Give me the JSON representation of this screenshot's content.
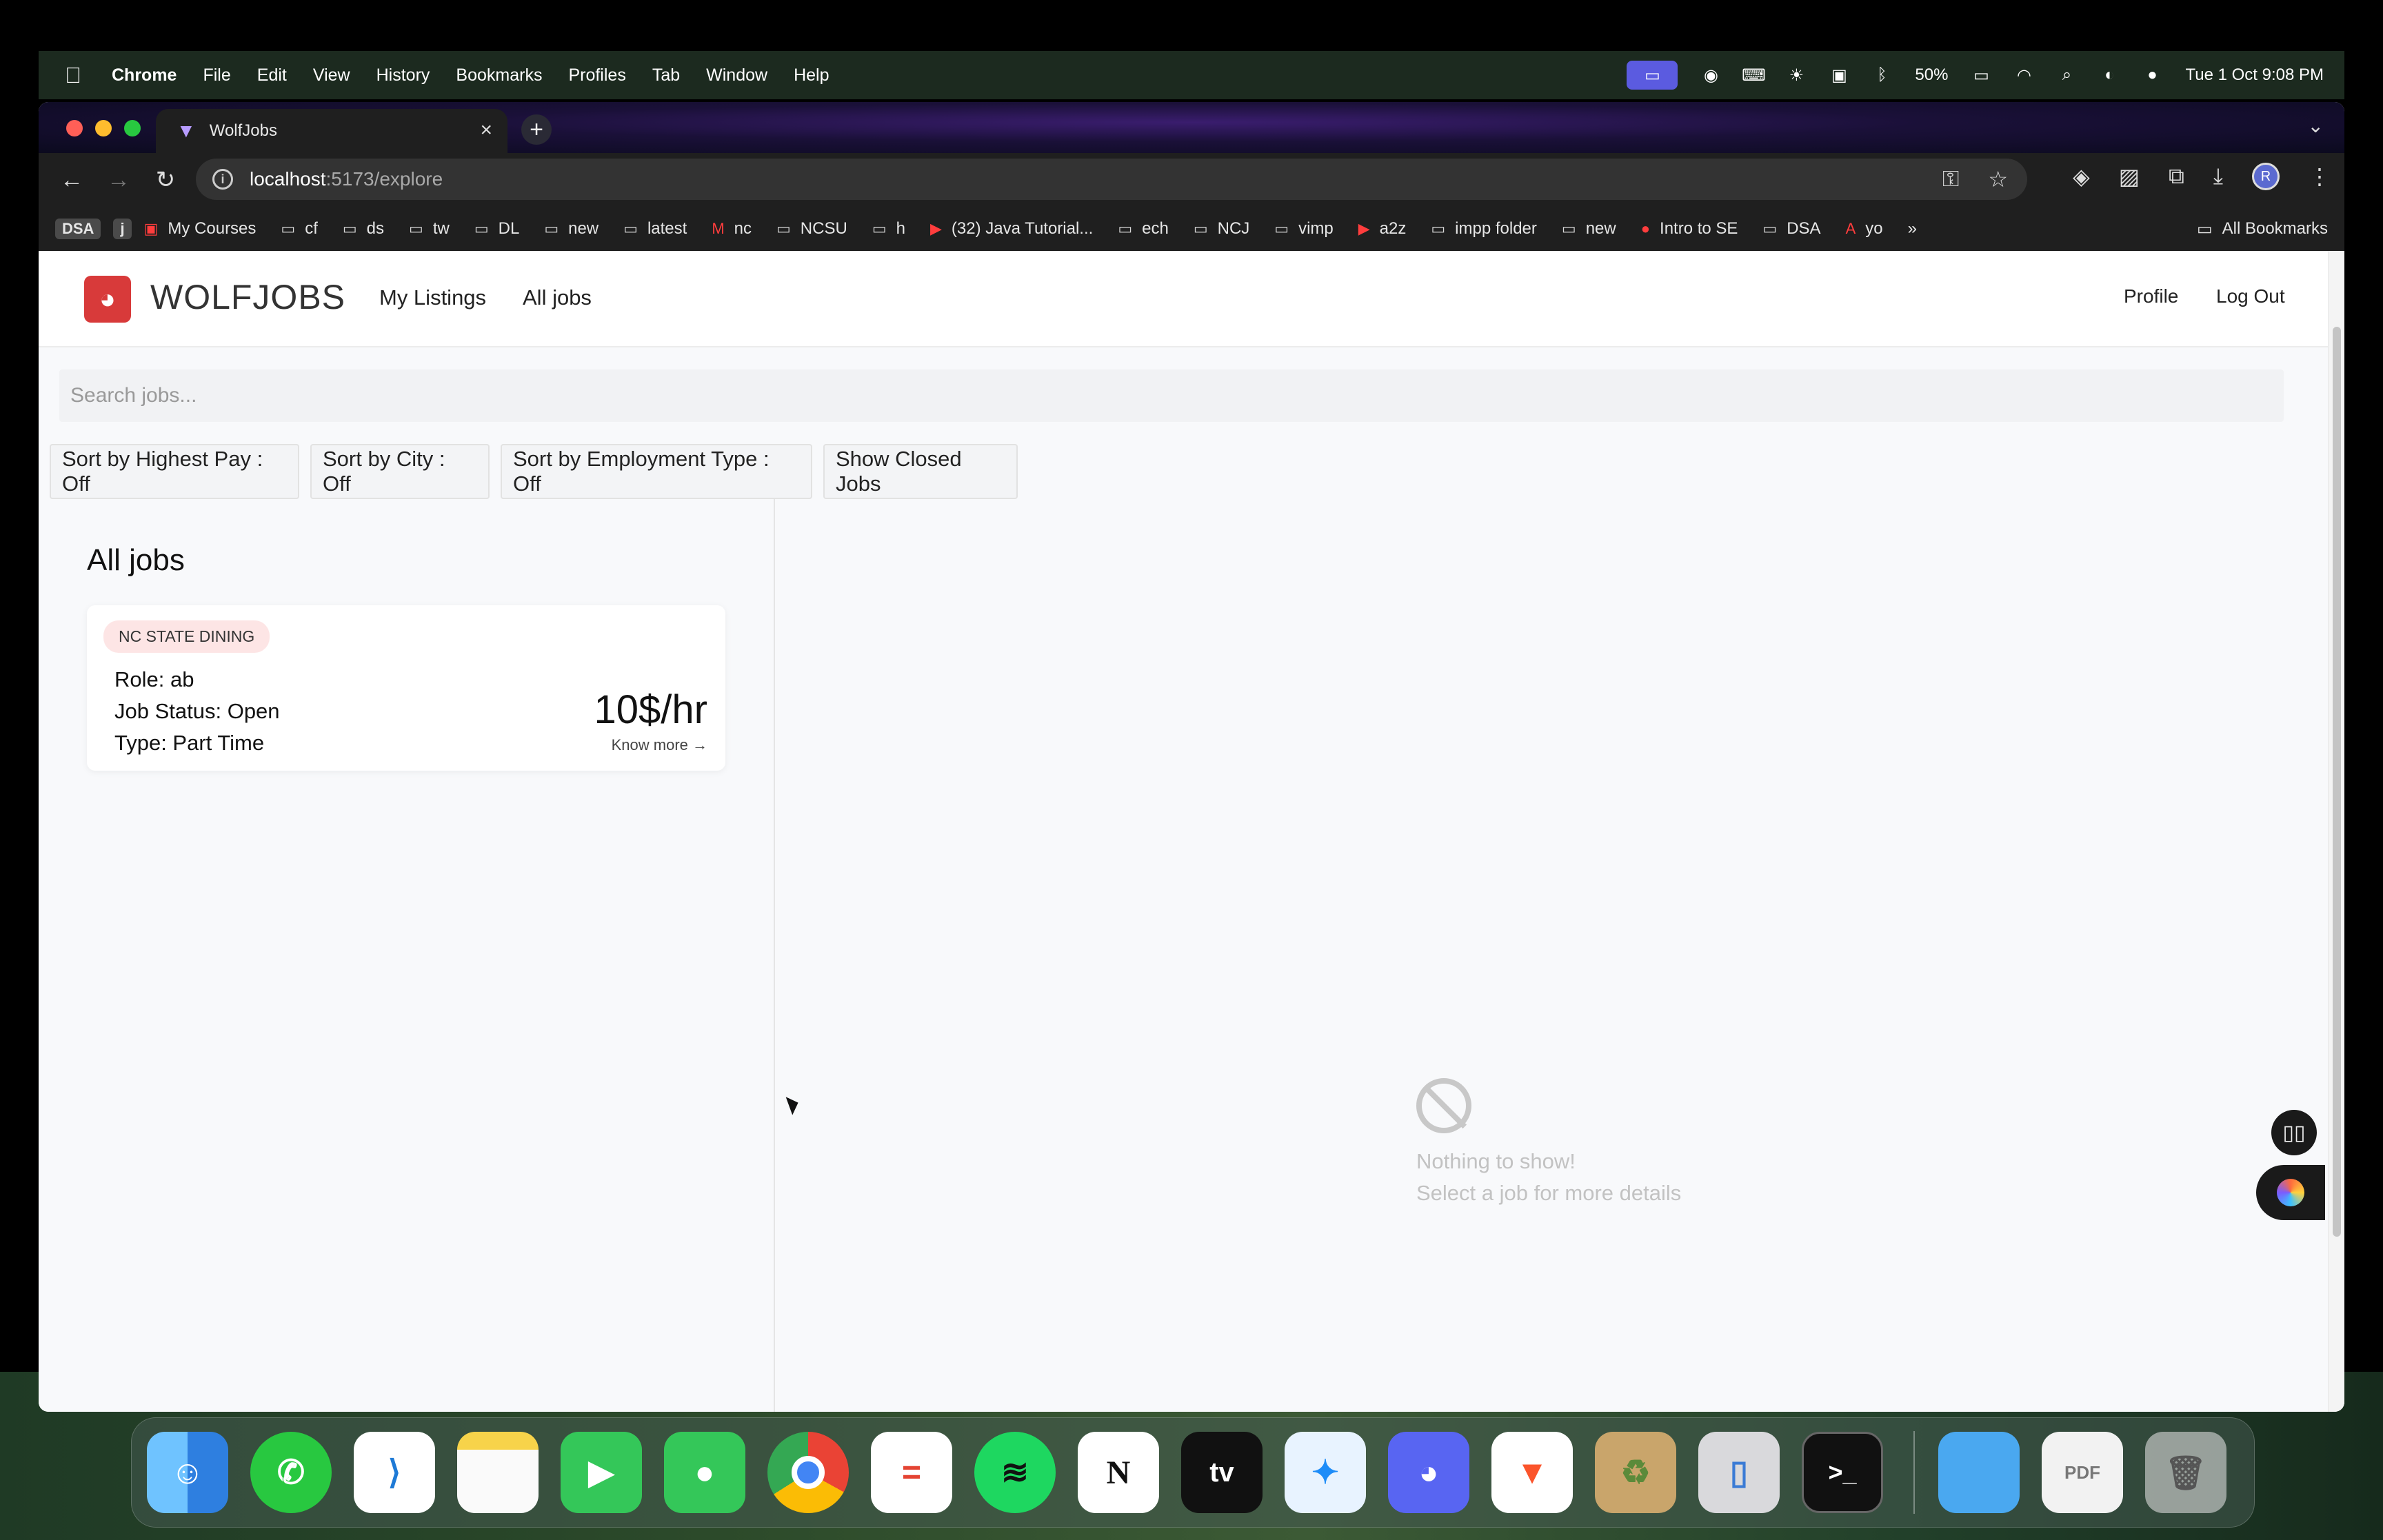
{
  "menubar": {
    "app": "Chrome",
    "items": [
      "File",
      "Edit",
      "View",
      "History",
      "Bookmarks",
      "Profiles",
      "Tab",
      "Window",
      "Help"
    ],
    "battery": "50%",
    "datetime": "Tue 1 Oct  9:08 PM"
  },
  "browser": {
    "tab_title": "WolfJobs",
    "url_host": "localhost",
    "url_path": ":5173/explore",
    "bookmarks": [
      "DSA",
      "j",
      "My Courses",
      "cf",
      "ds",
      "tw",
      "DL",
      "new",
      "latest",
      "nc",
      "NCSU",
      "h",
      "(32) Java Tutorial...",
      "ech",
      "NCJ",
      "vimp",
      "a2z",
      "impp folder",
      "new",
      "Intro to SE",
      "DSA",
      "yo"
    ],
    "overflow": "»",
    "all_bookmarks": "All Bookmarks",
    "avatar_letter": "R"
  },
  "app": {
    "brand": "WOLFJOBS",
    "nav": {
      "my_listings": "My Listings",
      "all_jobs": "All jobs",
      "profile": "Profile",
      "logout": "Log Out"
    },
    "search_placeholder": "Search jobs...",
    "sort_buttons": [
      "Sort by Highest Pay : Off",
      "Sort by City : Off",
      "Sort by Employment Type : Off",
      "Show Closed Jobs"
    ],
    "list_heading": "All jobs",
    "job": {
      "tag": "NC STATE DINING",
      "role": "Role: ab",
      "status": "Job Status: Open",
      "type": "Type: Part Time",
      "pay": "10$/hr",
      "know_more": "Know more →"
    },
    "empty": {
      "title": "Nothing to show!",
      "subtitle": "Select a job for more details"
    }
  },
  "colors": {
    "brand_red": "#d83a3a",
    "tag_bg": "#fde5e5"
  },
  "dock": [
    "finder",
    "whatsapp",
    "vscode",
    "notes",
    "facetime",
    "messages",
    "chrome",
    "todoist",
    "spotify",
    "notion",
    "appletv",
    "safari",
    "discord",
    "brave",
    "recycle",
    "iphone-mirroring",
    "terminal",
    "folder",
    "pdf",
    "trash"
  ]
}
